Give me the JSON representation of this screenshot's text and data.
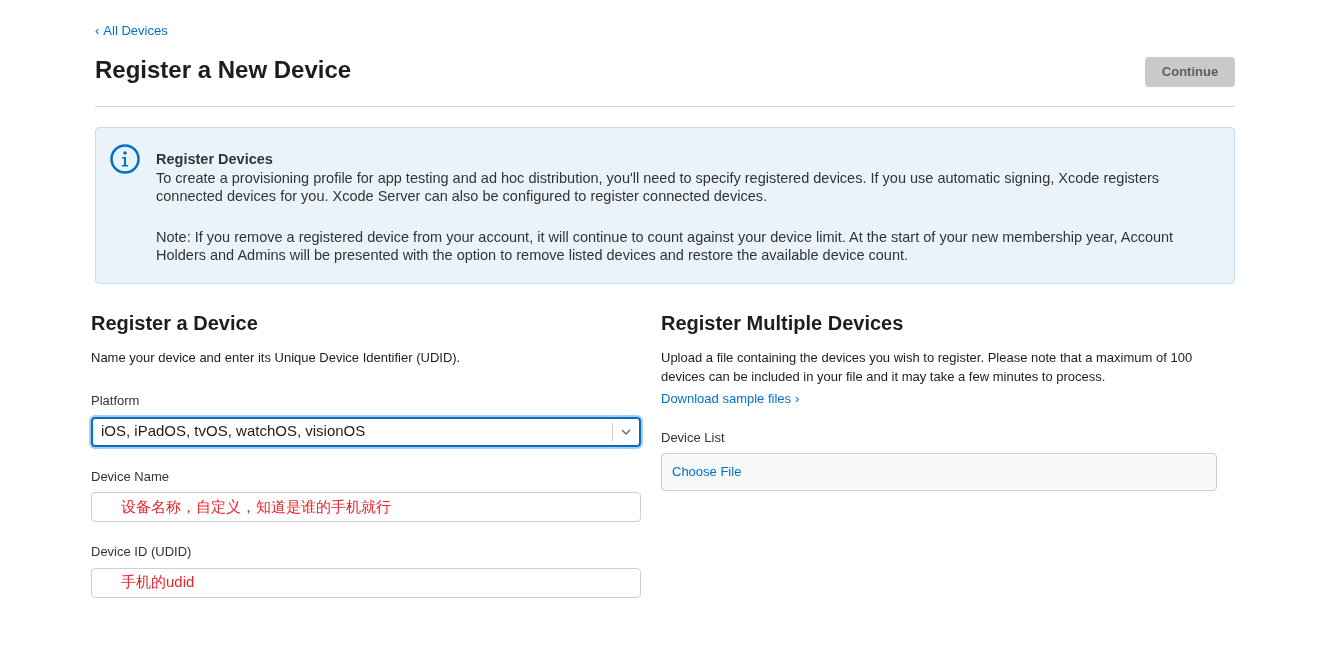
{
  "back_link": {
    "chevron": "‹",
    "label": "All Devices"
  },
  "header": {
    "title": "Register a New Device",
    "continue_button": {
      "label": "Continue",
      "disabled": true
    }
  },
  "info_box": {
    "title": "Register Devices",
    "paragraphs": [
      "To create a provisioning profile for app testing and ad hoc distribution, you'll need to specify registered devices. If you use automatic signing, Xcode registers connected devices for you. Xcode Server can also be configured to register connected devices.",
      "Note: If you remove a registered device from your account, it will continue to count against your device limit. At the start of your new membership year, Account Holders and Admins will be presented with the option to remove listed devices and restore the available device count."
    ]
  },
  "register_device": {
    "title": "Register a Device",
    "description": "Name your device and enter its Unique Device Identifier (UDID).",
    "fields": [
      {
        "kind": "select",
        "label": "Platform",
        "value": "iOS, iPadOS, tvOS, watchOS, visionOS",
        "focused": true
      },
      {
        "kind": "text",
        "label": "Device Name",
        "value": "设备名称，自定义，知道是谁的手机就行",
        "focused": false
      },
      {
        "kind": "text",
        "label": "Device ID (UDID)",
        "value": "手机的udid",
        "focused": false
      }
    ]
  },
  "register_multiple": {
    "title": "Register Multiple Devices",
    "description": "Upload a file containing the devices you wish to register. Please note that a maximum of 100 devices can be included in your file and it may take a few minutes to process.",
    "link": {
      "label": "Download sample files",
      "chevron": "›"
    },
    "field_label": "Device List",
    "file_button": "Choose File"
  }
}
